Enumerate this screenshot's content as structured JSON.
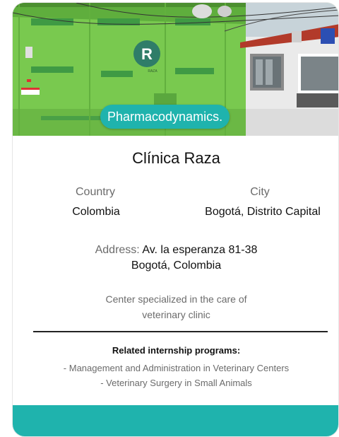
{
  "card": {
    "tag": "Pharmacodynamics.",
    "title": "Clínica Raza",
    "country_label": "Country",
    "country_value": "Colombia",
    "city_label": "City",
    "city_value": "Bogotá, Distrito Capital",
    "address_label": "Address:",
    "address_line1": "Av. la esperanza 81-38",
    "address_line2": "Bogotá, Colombia",
    "description_line1": "Center specialized in the care of",
    "description_line2": "veterinary clinic",
    "related_title": "Related internship programs:",
    "programs": [
      "- Management and Administration in Veterinary Centers",
      "- Veterinary Surgery in Small Animals"
    ],
    "photo_sign_letter": "R",
    "photo_sign_small": "RAZA"
  },
  "colors": {
    "accent": "#1fb3ad",
    "building_green": "#74c84f"
  }
}
